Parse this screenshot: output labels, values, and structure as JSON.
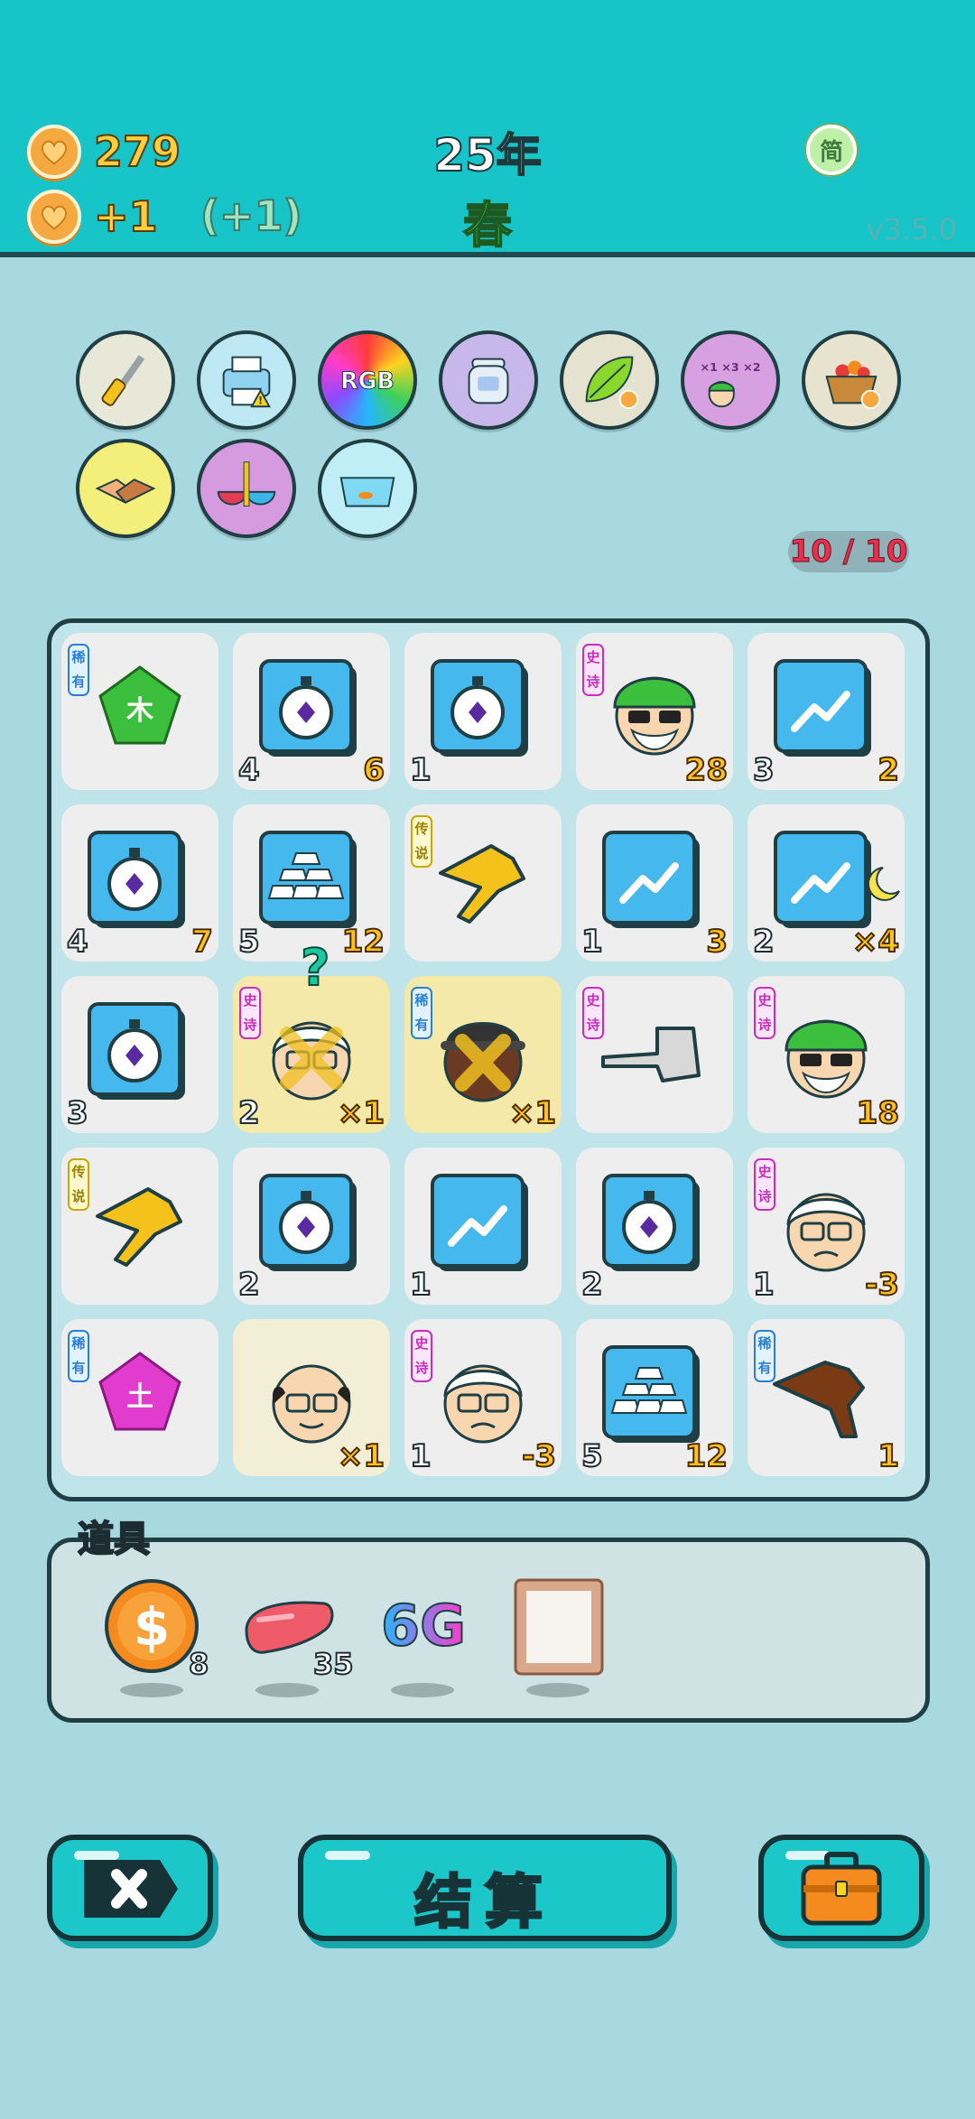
{
  "header": {
    "coins": "279",
    "income": "+1",
    "income_bonus": "(+1)",
    "year": "25年",
    "season": "春",
    "language_toggle": "简",
    "version": "v3.5.0"
  },
  "relics": [
    {
      "name": "screwdriver-icon",
      "bg": "#e8e8d8"
    },
    {
      "name": "printer-icon",
      "bg": "#bde8f4"
    },
    {
      "name": "rgb-icon",
      "bg": "#2b2b2b"
    },
    {
      "name": "jar-icon",
      "bg": "#c7b7ea"
    },
    {
      "name": "leaf-icon",
      "bg": "#e5e3cf"
    },
    {
      "name": "multiplier-face-icon",
      "bg": "#d7a0e0"
    },
    {
      "name": "fruit-basket-icon",
      "bg": "#e8e3cf"
    },
    {
      "name": "handshake-icon",
      "bg": "#f4ef7a"
    },
    {
      "name": "rice-bowls-icon",
      "bg": "#d69adf"
    },
    {
      "name": "fish-tank-icon",
      "bg": "#bfeef6"
    }
  ],
  "relic_rgb_text": "RGB",
  "relic_count": "10 / 10",
  "tags": {
    "rare": "稀有",
    "epic": "史诗",
    "legend": "传说"
  },
  "board": [
    [
      {
        "art": "wood-pentagon",
        "char": "木",
        "tag": "rare",
        "bl": "",
        "br": ""
      },
      {
        "art": "stopwatch",
        "tag": "",
        "bl": "4",
        "br": "6"
      },
      {
        "art": "stopwatch",
        "tag": "",
        "bl": "1",
        "br": ""
      },
      {
        "art": "green-hat-man",
        "tag": "epic",
        "bl": "",
        "br": "28"
      },
      {
        "art": "trend",
        "tag": "",
        "bl": "3",
        "br": "2"
      }
    ],
    [
      {
        "art": "stopwatch",
        "tag": "",
        "bl": "4",
        "br": "7"
      },
      {
        "art": "gold-bars",
        "tag": "",
        "bl": "5",
        "br": "12"
      },
      {
        "art": "yellow-hand",
        "tag": "legend",
        "bl": "",
        "br": ""
      },
      {
        "art": "trend",
        "tag": "",
        "bl": "1",
        "br": "3"
      },
      {
        "art": "trend-moon",
        "tag": "",
        "bl": "2",
        "br": "×4"
      }
    ],
    [
      {
        "art": "stopwatch",
        "tag": "",
        "bl": "3",
        "br": ""
      },
      {
        "art": "old-man-crossed",
        "tag": "epic",
        "bl": "2",
        "br": "×1",
        "hl": true
      },
      {
        "art": "dark-hat-man-crossed",
        "tag": "rare",
        "bl": "",
        "br": "×1",
        "hl": true
      },
      {
        "art": "gray-hand",
        "tag": "epic",
        "bl": "",
        "br": ""
      },
      {
        "art": "green-hat-man",
        "tag": "epic",
        "bl": "",
        "br": "18"
      }
    ],
    [
      {
        "art": "yellow-hand",
        "tag": "legend",
        "bl": "",
        "br": ""
      },
      {
        "art": "stopwatch",
        "tag": "",
        "bl": "2",
        "br": ""
      },
      {
        "art": "trend",
        "tag": "",
        "bl": "1",
        "br": ""
      },
      {
        "art": "stopwatch",
        "tag": "",
        "bl": "2",
        "br": ""
      },
      {
        "art": "old-man",
        "tag": "epic",
        "bl": "1",
        "br": "-3"
      }
    ],
    [
      {
        "art": "earth-pentagon",
        "char": "土",
        "tag": "rare",
        "bl": "",
        "br": ""
      },
      {
        "art": "bald-old-man",
        "tag": "",
        "bl": "",
        "br": "×1",
        "hl2": true
      },
      {
        "art": "old-man",
        "tag": "epic",
        "bl": "1",
        "br": "-3"
      },
      {
        "art": "gold-bars",
        "tag": "",
        "bl": "5",
        "br": "12"
      },
      {
        "art": "brown-hand",
        "tag": "rare",
        "bl": "",
        "br": "1"
      }
    ]
  ],
  "question_mark": "?",
  "items_title": "道具",
  "items": [
    {
      "name": "dollar-coin-icon",
      "count": "8"
    },
    {
      "name": "liver-icon",
      "count": "35"
    },
    {
      "name": "6g-icon",
      "text": "6G",
      "count": ""
    },
    {
      "name": "mirror-frame-icon",
      "count": ""
    }
  ],
  "buttons": {
    "cancel": "cancel-icon",
    "settle": "结算",
    "bag": "briefcase-icon"
  }
}
